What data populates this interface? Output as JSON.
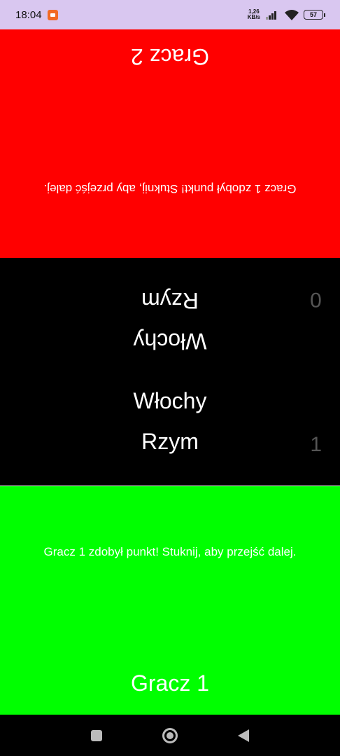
{
  "status_bar": {
    "time": "18:04",
    "net_speed_value": "1,26",
    "net_speed_unit": "KB/s",
    "battery": "57",
    "icons": [
      "screen-record-icon",
      "signal-icon",
      "wifi-icon",
      "battery-icon"
    ]
  },
  "player2": {
    "name": "Gracz 2",
    "message": "Gracz 1 zdobył punkt! Stuknij, aby przejść dalej.",
    "color": "#ff0000"
  },
  "middle": {
    "top_word_1": "Rzym",
    "top_word_2": "Włochy",
    "top_score": "0",
    "bottom_word_1": "Włochy",
    "bottom_word_2": "Rzym",
    "bottom_score": "1"
  },
  "player1": {
    "name": "Gracz 1",
    "message": "Gracz 1 zdobył punkt! Stuknij, aby przejść dalej.",
    "color": "#00ff00"
  },
  "nav_bar": {
    "icons": [
      "recents-icon",
      "home-icon",
      "back-icon"
    ]
  }
}
